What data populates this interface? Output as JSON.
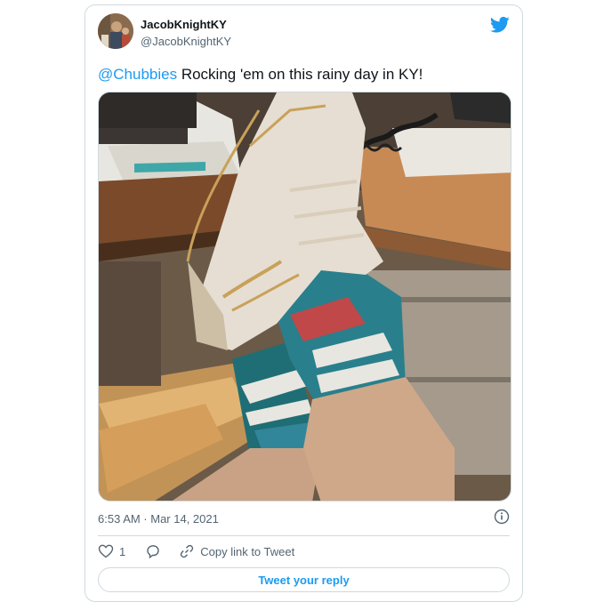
{
  "author": {
    "display_name": "JacobKnightKY",
    "handle": "@JacobKnightKY"
  },
  "tweet": {
    "mention": "@Chubbies",
    "body": " Rocking 'em on this rainy day in KY!",
    "timestamp": "6:53 AM · Mar 14, 2021"
  },
  "actions": {
    "like_count": "1",
    "copy_link_label": "Copy link to Tweet",
    "reply_button_label": "Tweet your reply"
  },
  "icons": {
    "brand": "twitter-bird-icon",
    "info": "info-icon",
    "like": "heart-icon",
    "reply": "speech-bubble-icon",
    "copy": "link-icon"
  },
  "colors": {
    "accent": "#1d9bf0",
    "text": "#0f1419",
    "secondary": "#536471",
    "border": "#cfd9de"
  }
}
